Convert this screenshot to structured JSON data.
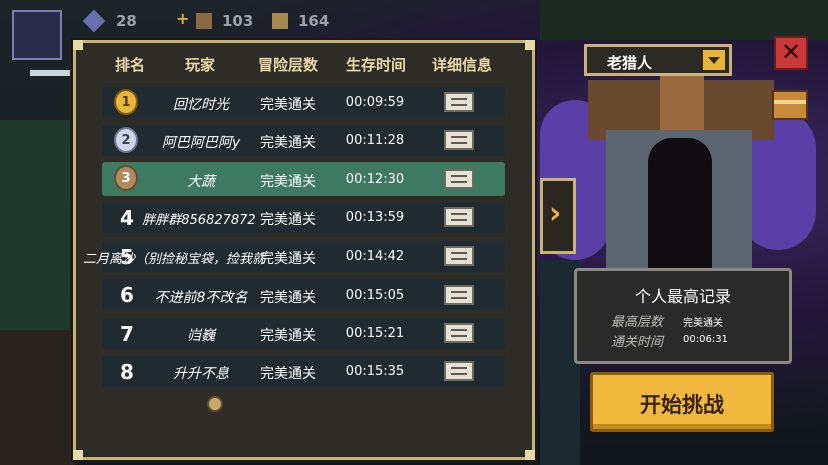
{
  "resources": {
    "gems": "28",
    "materials": "103",
    "coins": "164"
  },
  "leaderboard": {
    "headers": [
      "排名",
      "玩家",
      "冒险层数",
      "生存时间",
      "详细信息"
    ],
    "rows": [
      {
        "rank": "1",
        "player": "回忆时光",
        "floor": "完美通关",
        "time": "00:09:59"
      },
      {
        "rank": "2",
        "player": "阿巴阿巴阿y",
        "floor": "完美通关",
        "time": "00:11:28"
      },
      {
        "rank": "3",
        "player": "大蔬",
        "floor": "完美通关",
        "time": "00:12:30"
      },
      {
        "rank": "4",
        "player": "胖胖群856827872",
        "floor": "完美通关",
        "time": "00:13:59"
      },
      {
        "rank": "5",
        "player": "二月离沙（别捡秘宝袋，捡我就",
        "floor": "完美通关",
        "time": "00:14:42"
      },
      {
        "rank": "6",
        "player": "不进前8不改名",
        "floor": "完美通关",
        "time": "00:15:05"
      },
      {
        "rank": "7",
        "player": "岿巍",
        "floor": "完美通关",
        "time": "00:15:21"
      },
      {
        "rank": "8",
        "player": "升升不息",
        "floor": "完美通关",
        "time": "00:15:35"
      }
    ]
  },
  "character": {
    "selected": "老猎人"
  },
  "record": {
    "title": "个人最高记录",
    "floor_label": "最高层数",
    "floor_value": "完美通关",
    "time_label": "通关时间",
    "time_value": "00:06:31"
  },
  "start_button": "开始挑战",
  "colors": {
    "panel_border": "#c9b37a",
    "highlight_row": "#3e7a62",
    "start_button": "#f0b83c",
    "close_button": "#c83a3a"
  }
}
